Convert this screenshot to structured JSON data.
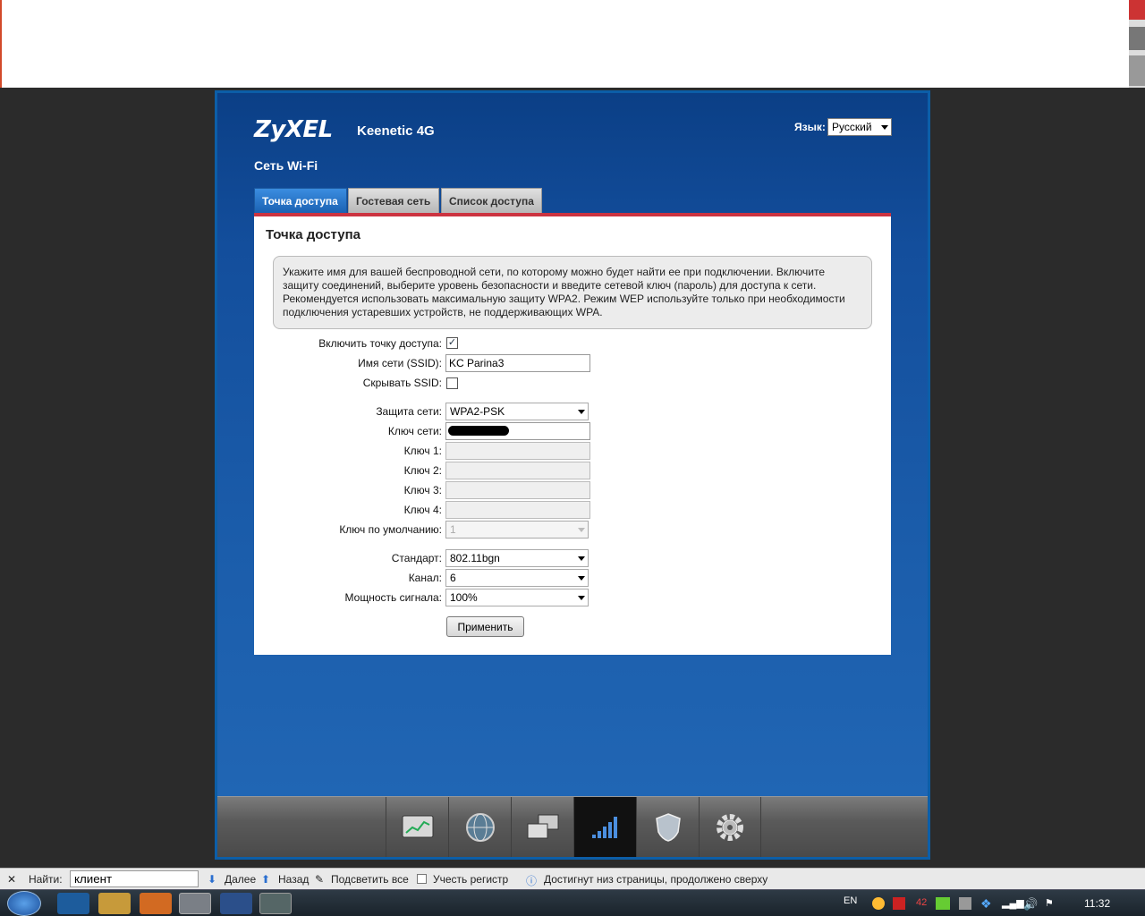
{
  "header": {
    "logo": "ZyXEL",
    "model": "Keenetic 4G",
    "page_title": "Сеть Wi-Fi",
    "language_label": "Язык:",
    "language_value": "Русский"
  },
  "tabs": [
    {
      "label": "Точка доступа",
      "active": true
    },
    {
      "label": "Гостевая сеть",
      "active": false
    },
    {
      "label": "Список доступа",
      "active": false
    }
  ],
  "panel": {
    "title": "Точка доступа",
    "info": "Укажите имя для вашей беспроводной сети, по которому можно будет найти ее при подключении. Включите защиту соединений, выберите уровень безопасности и введите сетевой ключ (пароль) для доступа к сети. Рекомендуется использовать максимальную защиту WPA2. Режим WEP используйте только при необходимости подключения устаревших устройств, не поддерживающих WPA."
  },
  "form": {
    "enable_ap_label": "Включить точку доступа:",
    "enable_ap_checked": true,
    "ssid_label": "Имя сети (SSID):",
    "ssid_value": "KC Parina3",
    "hide_ssid_label": "Скрывать SSID:",
    "hide_ssid_checked": false,
    "security_label": "Защита сети:",
    "security_value": "WPA2-PSK",
    "key_label": "Ключ сети:",
    "key1_label": "Ключ 1:",
    "key2_label": "Ключ 2:",
    "key3_label": "Ключ 3:",
    "key4_label": "Ключ 4:",
    "default_key_label": "Ключ по умолчанию:",
    "default_key_value": "1",
    "standard_label": "Стандарт:",
    "standard_value": "802.11bgn",
    "channel_label": "Канал:",
    "channel_value": "6",
    "power_label": "Мощность сигнала:",
    "power_value": "100%",
    "apply_label": "Применить"
  },
  "navbar": {
    "icons": [
      "monitor-chart-icon",
      "globe-icon",
      "network-computers-icon",
      "wifi-signal-icon",
      "shield-icon",
      "gear-icon"
    ],
    "active_index": 3
  },
  "findbar": {
    "find_label": "Найти:",
    "find_value": "клиент",
    "next_label": "Далее",
    "prev_label": "Назад",
    "highlight_label": "Подсветить все",
    "match_case_label": "Учесть регистр",
    "status": "Достигнут низ страницы, продолжено сверху"
  },
  "taskbar": {
    "lang": "EN",
    "tray_number": "42",
    "time": "11:32"
  },
  "colors": {
    "frame": "#0c5ea8",
    "tab_active": "#1b62b3",
    "accent_red": "#cc3340"
  }
}
